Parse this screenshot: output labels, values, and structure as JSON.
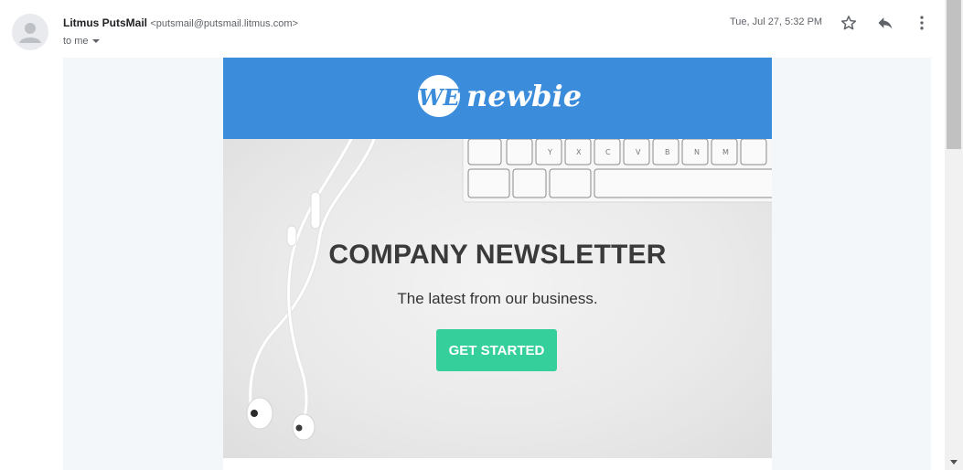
{
  "message": {
    "sender_name": "Litmus PutsMail",
    "sender_email": "<putsmail@putsmail.litmus.com>",
    "recipient": "to me",
    "date": "Tue, Jul 27, 5:32 PM",
    "icons": [
      "avatar-icon",
      "star-icon",
      "reply-icon",
      "more-vert-icon",
      "chevron-down-icon"
    ]
  },
  "email": {
    "logo_text": "newbie",
    "logo_mark": "WE",
    "headline": "COMPANY NEWSLETTER",
    "tagline": "The latest from our business.",
    "cta_label": "GET STARTED",
    "colors": {
      "banner": "#3b8ddb",
      "cta": "#35cf9b",
      "background": "#f4f7fa"
    }
  }
}
